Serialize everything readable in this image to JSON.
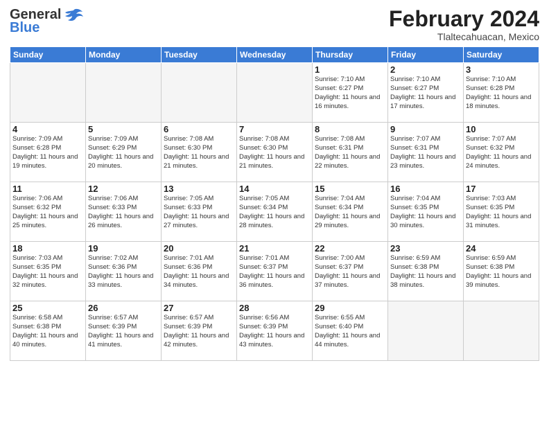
{
  "header": {
    "logo_general": "General",
    "logo_blue": "Blue",
    "month_year": "February 2024",
    "location": "Tlaltecahuacan, Mexico"
  },
  "days_of_week": [
    "Sunday",
    "Monday",
    "Tuesday",
    "Wednesday",
    "Thursday",
    "Friday",
    "Saturday"
  ],
  "weeks": [
    [
      {
        "day": "",
        "info": "",
        "empty": true
      },
      {
        "day": "",
        "info": "",
        "empty": true
      },
      {
        "day": "",
        "info": "",
        "empty": true
      },
      {
        "day": "",
        "info": "",
        "empty": true
      },
      {
        "day": "1",
        "info": "Sunrise: 7:10 AM\nSunset: 6:27 PM\nDaylight: 11 hours and 16 minutes.",
        "empty": false
      },
      {
        "day": "2",
        "info": "Sunrise: 7:10 AM\nSunset: 6:27 PM\nDaylight: 11 hours and 17 minutes.",
        "empty": false
      },
      {
        "day": "3",
        "info": "Sunrise: 7:10 AM\nSunset: 6:28 PM\nDaylight: 11 hours and 18 minutes.",
        "empty": false
      }
    ],
    [
      {
        "day": "4",
        "info": "Sunrise: 7:09 AM\nSunset: 6:28 PM\nDaylight: 11 hours and 19 minutes.",
        "empty": false
      },
      {
        "day": "5",
        "info": "Sunrise: 7:09 AM\nSunset: 6:29 PM\nDaylight: 11 hours and 20 minutes.",
        "empty": false
      },
      {
        "day": "6",
        "info": "Sunrise: 7:08 AM\nSunset: 6:30 PM\nDaylight: 11 hours and 21 minutes.",
        "empty": false
      },
      {
        "day": "7",
        "info": "Sunrise: 7:08 AM\nSunset: 6:30 PM\nDaylight: 11 hours and 21 minutes.",
        "empty": false
      },
      {
        "day": "8",
        "info": "Sunrise: 7:08 AM\nSunset: 6:31 PM\nDaylight: 11 hours and 22 minutes.",
        "empty": false
      },
      {
        "day": "9",
        "info": "Sunrise: 7:07 AM\nSunset: 6:31 PM\nDaylight: 11 hours and 23 minutes.",
        "empty": false
      },
      {
        "day": "10",
        "info": "Sunrise: 7:07 AM\nSunset: 6:32 PM\nDaylight: 11 hours and 24 minutes.",
        "empty": false
      }
    ],
    [
      {
        "day": "11",
        "info": "Sunrise: 7:06 AM\nSunset: 6:32 PM\nDaylight: 11 hours and 25 minutes.",
        "empty": false
      },
      {
        "day": "12",
        "info": "Sunrise: 7:06 AM\nSunset: 6:33 PM\nDaylight: 11 hours and 26 minutes.",
        "empty": false
      },
      {
        "day": "13",
        "info": "Sunrise: 7:05 AM\nSunset: 6:33 PM\nDaylight: 11 hours and 27 minutes.",
        "empty": false
      },
      {
        "day": "14",
        "info": "Sunrise: 7:05 AM\nSunset: 6:34 PM\nDaylight: 11 hours and 28 minutes.",
        "empty": false
      },
      {
        "day": "15",
        "info": "Sunrise: 7:04 AM\nSunset: 6:34 PM\nDaylight: 11 hours and 29 minutes.",
        "empty": false
      },
      {
        "day": "16",
        "info": "Sunrise: 7:04 AM\nSunset: 6:35 PM\nDaylight: 11 hours and 30 minutes.",
        "empty": false
      },
      {
        "day": "17",
        "info": "Sunrise: 7:03 AM\nSunset: 6:35 PM\nDaylight: 11 hours and 31 minutes.",
        "empty": false
      }
    ],
    [
      {
        "day": "18",
        "info": "Sunrise: 7:03 AM\nSunset: 6:35 PM\nDaylight: 11 hours and 32 minutes.",
        "empty": false
      },
      {
        "day": "19",
        "info": "Sunrise: 7:02 AM\nSunset: 6:36 PM\nDaylight: 11 hours and 33 minutes.",
        "empty": false
      },
      {
        "day": "20",
        "info": "Sunrise: 7:01 AM\nSunset: 6:36 PM\nDaylight: 11 hours and 34 minutes.",
        "empty": false
      },
      {
        "day": "21",
        "info": "Sunrise: 7:01 AM\nSunset: 6:37 PM\nDaylight: 11 hours and 36 minutes.",
        "empty": false
      },
      {
        "day": "22",
        "info": "Sunrise: 7:00 AM\nSunset: 6:37 PM\nDaylight: 11 hours and 37 minutes.",
        "empty": false
      },
      {
        "day": "23",
        "info": "Sunrise: 6:59 AM\nSunset: 6:38 PM\nDaylight: 11 hours and 38 minutes.",
        "empty": false
      },
      {
        "day": "24",
        "info": "Sunrise: 6:59 AM\nSunset: 6:38 PM\nDaylight: 11 hours and 39 minutes.",
        "empty": false
      }
    ],
    [
      {
        "day": "25",
        "info": "Sunrise: 6:58 AM\nSunset: 6:38 PM\nDaylight: 11 hours and 40 minutes.",
        "empty": false
      },
      {
        "day": "26",
        "info": "Sunrise: 6:57 AM\nSunset: 6:39 PM\nDaylight: 11 hours and 41 minutes.",
        "empty": false
      },
      {
        "day": "27",
        "info": "Sunrise: 6:57 AM\nSunset: 6:39 PM\nDaylight: 11 hours and 42 minutes.",
        "empty": false
      },
      {
        "day": "28",
        "info": "Sunrise: 6:56 AM\nSunset: 6:39 PM\nDaylight: 11 hours and 43 minutes.",
        "empty": false
      },
      {
        "day": "29",
        "info": "Sunrise: 6:55 AM\nSunset: 6:40 PM\nDaylight: 11 hours and 44 minutes.",
        "empty": false
      },
      {
        "day": "",
        "info": "",
        "empty": true
      },
      {
        "day": "",
        "info": "",
        "empty": true
      }
    ]
  ]
}
